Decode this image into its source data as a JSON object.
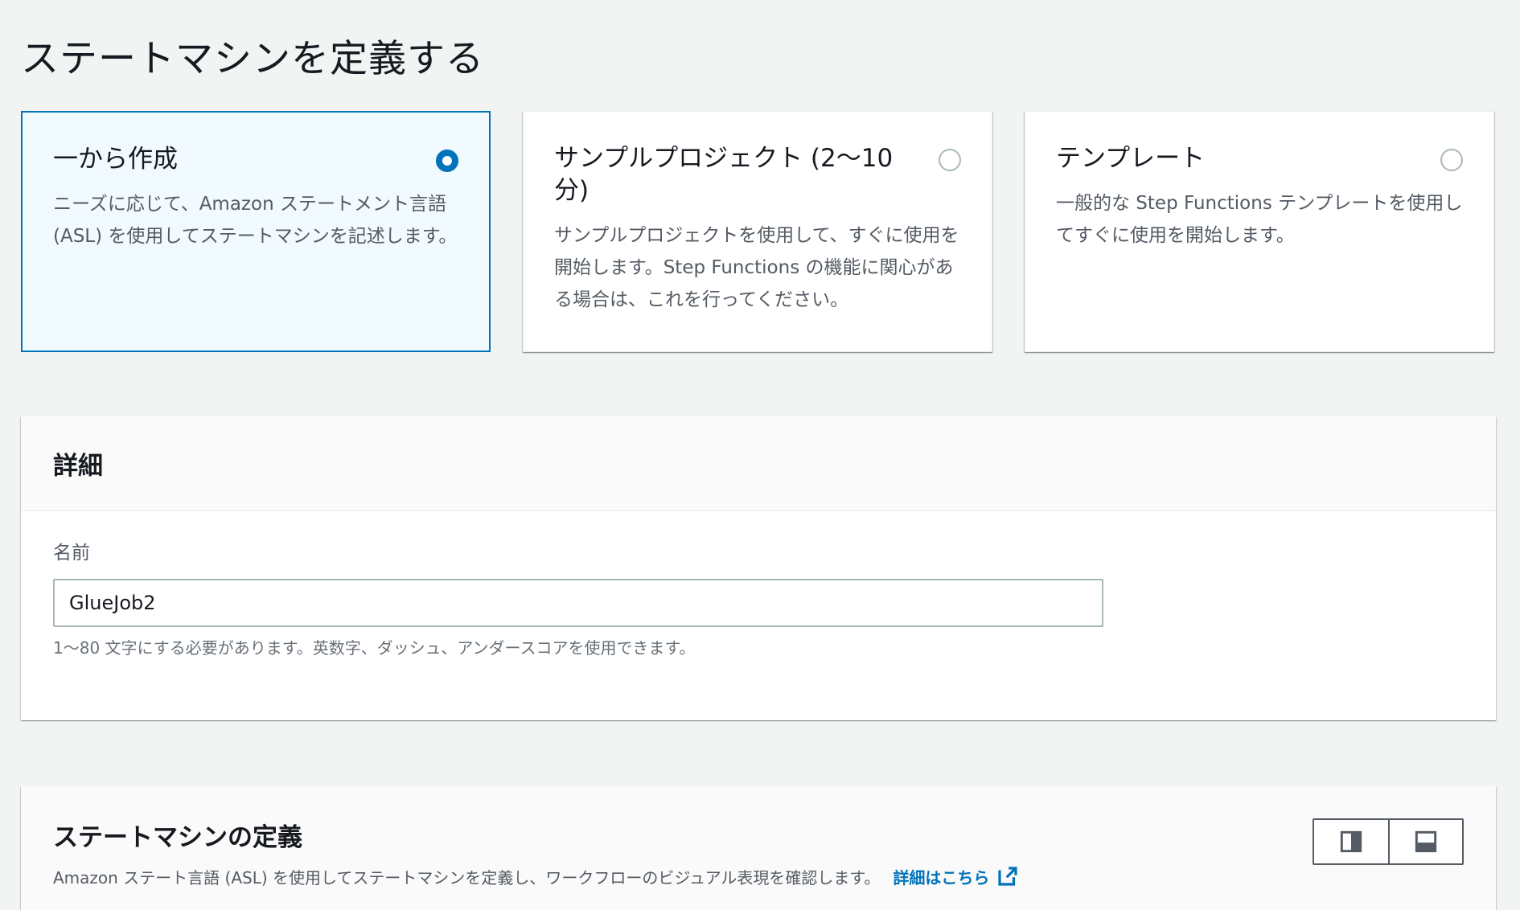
{
  "page": {
    "title": "ステートマシンを定義する"
  },
  "options": [
    {
      "title": "一から作成",
      "description": "ニーズに応じて、Amazon ステートメント言語 (ASL) を使用してステートマシンを記述します。",
      "selected": true
    },
    {
      "title": "サンプルプロジェクト (2〜10分)",
      "description": "サンプルプロジェクトを使用して、すぐに使用を開始します。Step Functions の機能に関心がある場合は、これを行ってください。",
      "selected": false
    },
    {
      "title": "テンプレート",
      "description": "一般的な Step Functions テンプレートを使用してすぐに使用を開始します。",
      "selected": false
    }
  ],
  "details": {
    "heading": "詳細",
    "name_label": "名前",
    "name_value": "GlueJob2",
    "name_hint": "1〜80 文字にする必要があります。英数字、ダッシュ、アンダースコアを使用できます。"
  },
  "definition": {
    "heading": "ステートマシンの定義",
    "description": "Amazon ステート言語 (ASL) を使用してステートマシンを定義し、ワークフローのビジュアル表現を確認します。",
    "link_label": "詳細はこちら"
  },
  "colors": {
    "accent": "#0073bb",
    "selected_bg": "#f1faff",
    "background": "#f2f3f3"
  },
  "icons": {
    "link": "external-link-icon",
    "toggle_side": "layout-side-icon",
    "toggle_bottom": "layout-bottom-icon"
  }
}
